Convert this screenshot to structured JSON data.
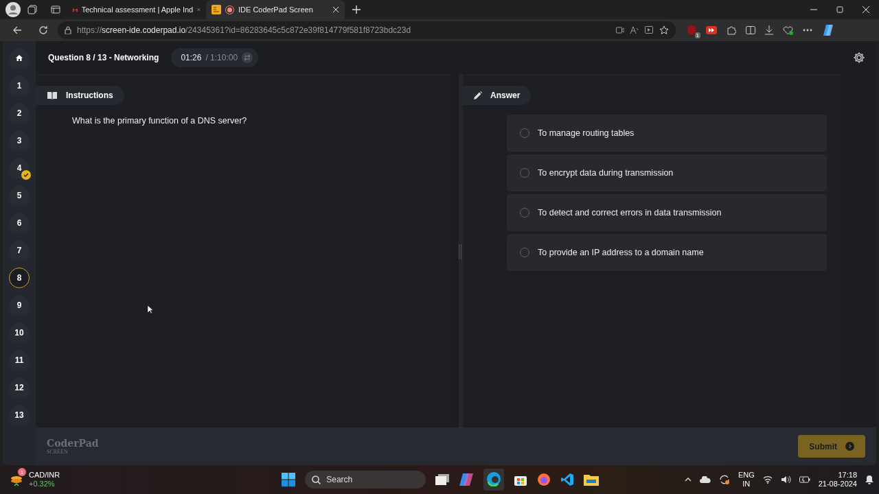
{
  "browser": {
    "tabs": [
      {
        "title": "Technical assessment | Apple Ind",
        "kind": "mail",
        "selected": false
      },
      {
        "title": "IDE CoderPad Screen",
        "kind": "recording",
        "selected": true
      }
    ],
    "url": {
      "scheme": "https://",
      "host": "screen-ide.coderpad.io",
      "path": "/24345361?id=86283645c5c872e39f814779f581f8723bdc23d"
    },
    "extension_badge": "1"
  },
  "header": {
    "title": "Question 8 / 13 - Networking",
    "elapsed": "01:26",
    "total": "/ 1:10:00"
  },
  "questions": [
    {
      "label": "1",
      "answered": false,
      "selected": false
    },
    {
      "label": "2",
      "answered": false,
      "selected": false
    },
    {
      "label": "3",
      "answered": false,
      "selected": false
    },
    {
      "label": "4",
      "answered": true,
      "selected": false
    },
    {
      "label": "5",
      "answered": false,
      "selected": false
    },
    {
      "label": "6",
      "answered": false,
      "selected": false
    },
    {
      "label": "7",
      "answered": false,
      "selected": false
    },
    {
      "label": "8",
      "answered": false,
      "selected": true
    },
    {
      "label": "9",
      "answered": false,
      "selected": false
    },
    {
      "label": "10",
      "answered": false,
      "selected": false
    },
    {
      "label": "11",
      "answered": false,
      "selected": false
    },
    {
      "label": "12",
      "answered": false,
      "selected": false
    },
    {
      "label": "13",
      "answered": false,
      "selected": false
    }
  ],
  "instructions": {
    "tab": "Instructions",
    "question": "What is the primary function of a DNS server?"
  },
  "answer": {
    "tab": "Answer",
    "options": [
      {
        "text": "To manage routing tables",
        "selected": false
      },
      {
        "text": "To encrypt data during transmission",
        "selected": false
      },
      {
        "text": "To detect and correct errors in data transmission",
        "selected": false
      },
      {
        "text": "To provide an IP address to a domain name",
        "selected": false
      }
    ]
  },
  "footer": {
    "logo": "CoderPad",
    "logo_sub": "SCREEN",
    "submit": "Submit"
  },
  "taskbar": {
    "widget": {
      "label": "CAD/INR",
      "change": "+0.32%",
      "badge": "1"
    },
    "search": {
      "placeholder": "Search"
    },
    "language": "ENG",
    "region": "IN",
    "time": "17:18",
    "date": "21-08-2024"
  }
}
